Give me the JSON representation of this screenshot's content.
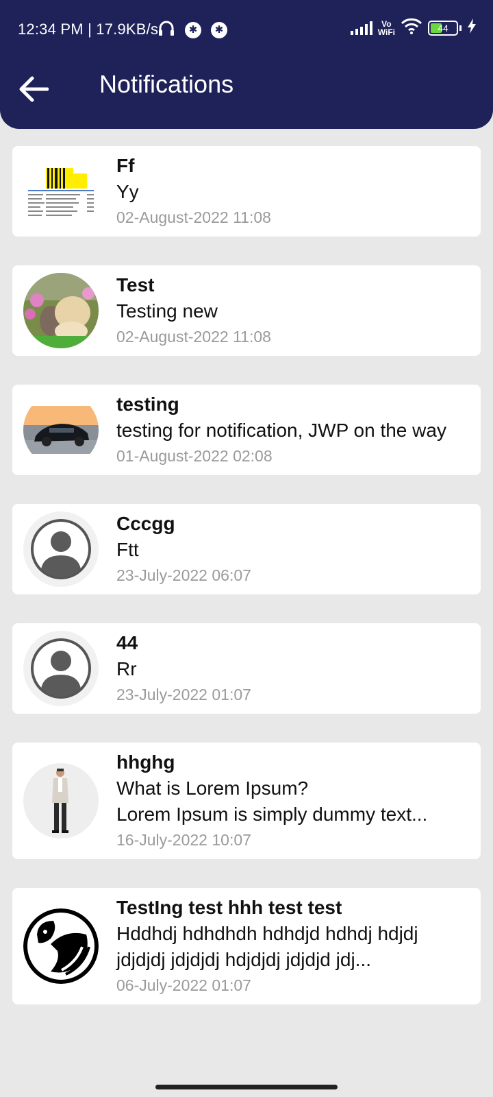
{
  "status": {
    "time_speed": "12:34 PM | 17.9KB/s",
    "vowifi_top": "Vo",
    "vowifi_bottom": "WiFi",
    "battery": "44"
  },
  "header": {
    "title": "Notifications"
  },
  "notifications": [
    {
      "title": "Ff",
      "body": "Yy",
      "date": "02-August-2022 11:08",
      "thumb": "spreadsheet-image"
    },
    {
      "title": "Test",
      "body": "Testing new",
      "date": "02-August-2022 11:08",
      "thumb": "puppy-kitten-image"
    },
    {
      "title": "testing",
      "body": "testing for notification, JWP on the way",
      "date": "01-August-2022 02:08",
      "thumb": "car-image"
    },
    {
      "title": "Cccgg",
      "body": "Ftt",
      "date": "23-July-2022 06:07",
      "thumb": "default-avatar"
    },
    {
      "title": "44",
      "body": "Rr",
      "date": "23-July-2022 01:07",
      "thumb": "default-avatar"
    },
    {
      "title": "hhghg",
      "body": "What is Lorem Ipsum?\nLorem Ipsum is simply dummy text...",
      "date": "16-July-2022 10:07",
      "thumb": "man-in-suit-image"
    },
    {
      "title": "TestIng test hhh test test",
      "body": "Hddhdj hdhdhdh hdhdjd hdhdj hdjdj jdjdjdj jdjdjdj hdjdjdj jdjdjd jdj...",
      "date": "06-July-2022 01:07",
      "thumb": "logo-image"
    }
  ]
}
